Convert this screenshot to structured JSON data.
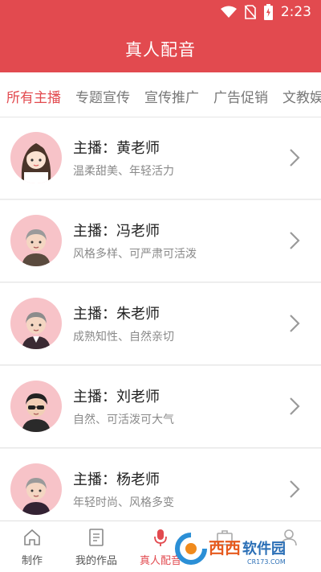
{
  "status": {
    "time": "2:23"
  },
  "header": {
    "title": "真人配音"
  },
  "tabs": [
    {
      "label": "所有主播",
      "active": true
    },
    {
      "label": "专题宣传",
      "active": false
    },
    {
      "label": "宣传推广",
      "active": false
    },
    {
      "label": "广告促销",
      "active": false
    },
    {
      "label": "文教娱",
      "active": false
    }
  ],
  "anchors": [
    {
      "name": "主播：黄老师",
      "desc": "温柔甜美、年轻活力"
    },
    {
      "name": "主播：冯老师",
      "desc": "风格多样、可严肃可活泼"
    },
    {
      "name": "主播：朱老师",
      "desc": "成熟知性、自然亲切"
    },
    {
      "name": "主播：刘老师",
      "desc": "自然、可活泼可大气"
    },
    {
      "name": "主播：杨老师",
      "desc": "年轻时尚、风格多变"
    }
  ],
  "nav": [
    {
      "label": "制作",
      "icon": "home-icon"
    },
    {
      "label": "我的作品",
      "icon": "document-icon"
    },
    {
      "label": "真人配音",
      "icon": "mic-icon",
      "active": true
    },
    {
      "label": "",
      "icon": "briefcase-icon"
    },
    {
      "label": "",
      "icon": "user-icon"
    }
  ],
  "watermark": {
    "brand": "西西软件园",
    "site": "CR173.COM"
  },
  "colors": {
    "accent": "#e24a4f",
    "avatar_bg": "#f7c3c8"
  }
}
